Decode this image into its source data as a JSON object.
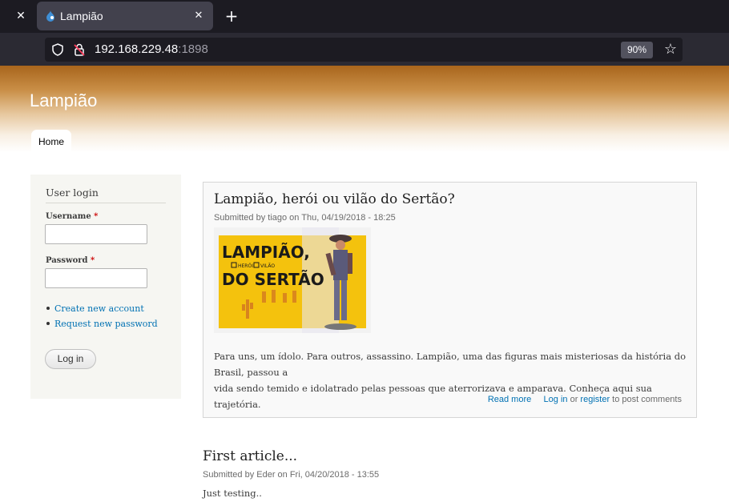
{
  "browser": {
    "tab_title": "Lampião",
    "url_host": "192.168.229.48",
    "url_port": ":1898",
    "zoom": "90%"
  },
  "site": {
    "name": "Lampião",
    "nav": {
      "home_label": "Home"
    }
  },
  "login_block": {
    "title": "User login",
    "username_label": "Username",
    "password_label": "Password",
    "required_marker": "*",
    "links": [
      {
        "label": "Create new account"
      },
      {
        "label": "Request new password"
      }
    ],
    "submit_label": "Log in"
  },
  "articles": [
    {
      "title": "Lampião, herói ou vilão do Sertão?",
      "submitted": "Submitted by tiago on Thu, 04/19/2018 - 18:25",
      "image_text": {
        "line1": "LAMPIÃO,",
        "herói": "HERÓI",
        "vilão": "VILÃO",
        "line2": "DO SERTÃO"
      },
      "body_line1": "Para uns, um ídolo. Para outros, assassino. Lampião, uma das figuras mais misteriosas da história do Brasil, passou a",
      "body_line2": "vida sendo temido e idolatrado pelas pessoas que aterrorizava e amparava. Conheça aqui sua trajetória.",
      "read_more": "Read more",
      "log_in": "Log in",
      "or": "or",
      "register": "register",
      "to_post": "to post comments"
    },
    {
      "title": "First article...",
      "submitted": "Submitted by Eder on Fri, 04/20/2018 - 13:55",
      "body": "Just testing.."
    }
  ],
  "colors": {
    "link": "#0071b3",
    "header_top": "#a8651c",
    "sidebar_bg": "#f6f6f2"
  }
}
